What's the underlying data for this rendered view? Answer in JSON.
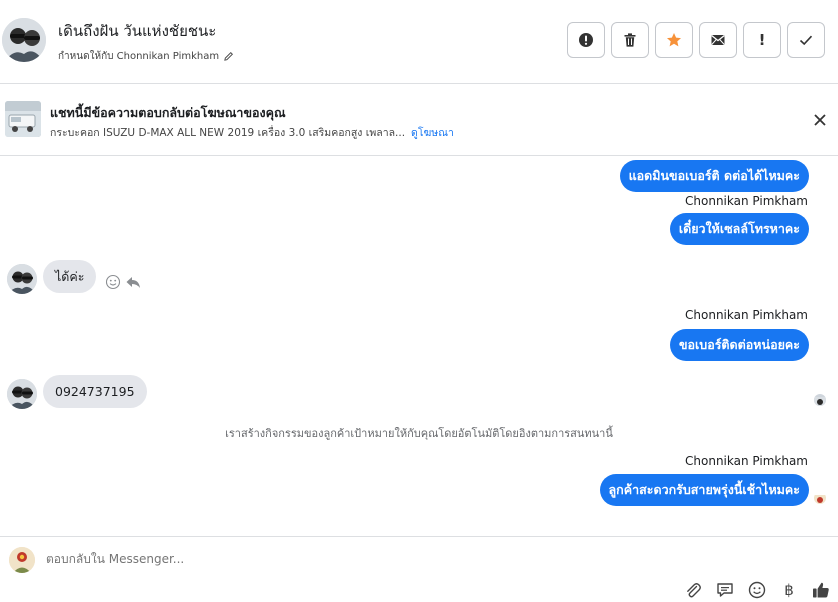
{
  "header": {
    "contact_name": "เดินถึงฝัน วันแห่งชัยชนะ",
    "assigned_label": "กำหนดให้กับ Chonnikan Pimkham",
    "toolbar": [
      {
        "icon": "alert-circle-icon"
      },
      {
        "icon": "trash-icon"
      },
      {
        "icon": "star-icon",
        "color": "#f7923a"
      },
      {
        "icon": "envelope-icon"
      },
      {
        "icon": "exclamation-icon",
        "label": "!"
      },
      {
        "icon": "check-icon"
      }
    ]
  },
  "ad": {
    "title": "แชทนี้มีข้อความตอบกลับต่อโฆษณาของคุณ",
    "description": "กระบะคอก ISUZU D-MAX ALL NEW 2019 เครื่อง 3.0 เสริมคอกสูง เพลาล...",
    "link": "ดูโฆษณา"
  },
  "messages": {
    "m1": "แอดมินขอเบอร์ติ ดต่อได้ไหมคะ",
    "s1": "Chonnikan Pimkham",
    "m2": "เดี๋ยวให้เซลล์โทรหาคะ",
    "m3": "ได้ค่ะ",
    "s2": "Chonnikan Pimkham",
    "m4": "ขอเบอร์ติดต่อหน่อยคะ",
    "m5": "0924737195",
    "system": "เราสร้างกิจกรรมของลูกค้าเป้าหมายให้กับคุณโดยอัตโนมัติโดยอิงตามการสนทนานี้",
    "s3": "Chonnikan Pimkham",
    "m6": "ลูกค้าสะดวกรับสายพรุ่งนี้เช้าไหมคะ"
  },
  "composer": {
    "placeholder": "ตอบกลับใน Messenger..."
  },
  "colors": {
    "accent": "#1877f2",
    "incoming_bubble": "#e4e6eb",
    "star": "#f7923a"
  }
}
